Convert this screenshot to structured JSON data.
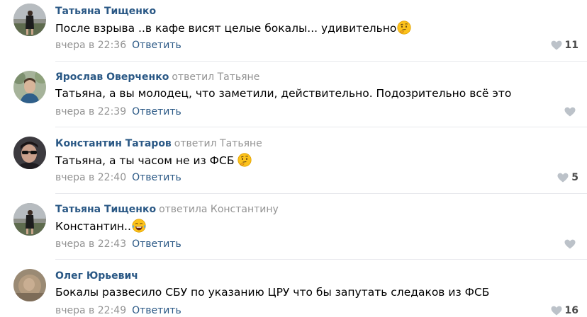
{
  "comments": [
    {
      "author": "Татьяна Тищенко",
      "reply_to": "",
      "text": "После взрыва ..в кафе висят целые бокалы... удивительно",
      "emoji": "thinking-face-icon",
      "date": "вчера в 22:36",
      "reply_label": "Ответить",
      "likes": "11",
      "avatar": "avatar-photo-woman-dark"
    },
    {
      "author": "Ярослав Оверченко",
      "reply_to": "ответил Татьяне",
      "text": "Татьяна, а вы молодец, что заметили, действительно. Подозрительно всё это",
      "emoji": "",
      "date": "вчера в 22:39",
      "reply_label": "Ответить",
      "likes": "",
      "avatar": "avatar-photo-man-trees"
    },
    {
      "author": "Константин Татаров",
      "reply_to": "ответил Татьяне",
      "text": "Татьяна, а ты часом не из ФСБ",
      "emoji": "thinking-face-icon",
      "date": "вчера в 22:40",
      "reply_label": "Ответить",
      "likes": "5",
      "avatar": "avatar-photo-man-sunglasses"
    },
    {
      "author": "Татьяна Тищенко",
      "reply_to": "ответила Константину",
      "text": "Константин..",
      "emoji": "tears-of-joy-icon",
      "date": "вчера в 22:43",
      "reply_label": "Ответить",
      "likes": "",
      "avatar": "avatar-photo-woman-dark"
    },
    {
      "author": "Олег Юрьевич",
      "reply_to": "",
      "text": "Бокалы развесило СБУ по указанию ЦРУ что бы запутать следаков из ФСБ",
      "emoji": "",
      "date": "вчера в 22:49",
      "reply_label": "Ответить",
      "likes": "16",
      "avatar": "avatar-photo-blurry-brown"
    }
  ],
  "colors": {
    "link": "#2a5885",
    "muted": "#939393",
    "separator": "#e7e8ec",
    "heart": "#bcc2c9"
  }
}
